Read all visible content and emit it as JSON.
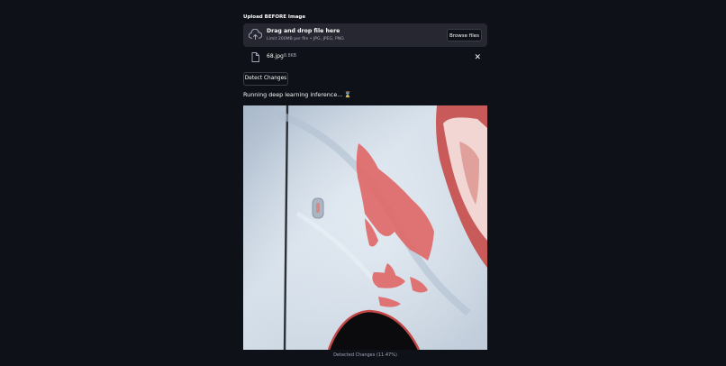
{
  "uploader": {
    "label": "Upload BEFORE Image",
    "drop_title": "Drag and drop file here",
    "limit_text": "Limit 200MB per file • JPG, JPEG, PNG",
    "browse_label": "Browse files"
  },
  "file": {
    "name": "68.jpg",
    "size": "8.8KB",
    "remove_icon": "✕"
  },
  "detect_button": "Detect Changes",
  "status": {
    "text": "Running deep learning inference...",
    "icon": "⌛"
  },
  "result": {
    "caption": "Detected Changes (11.47%)",
    "overlay_color": "#e06a6a"
  },
  "colors": {
    "background": "#0e1117",
    "panel": "#262730"
  }
}
